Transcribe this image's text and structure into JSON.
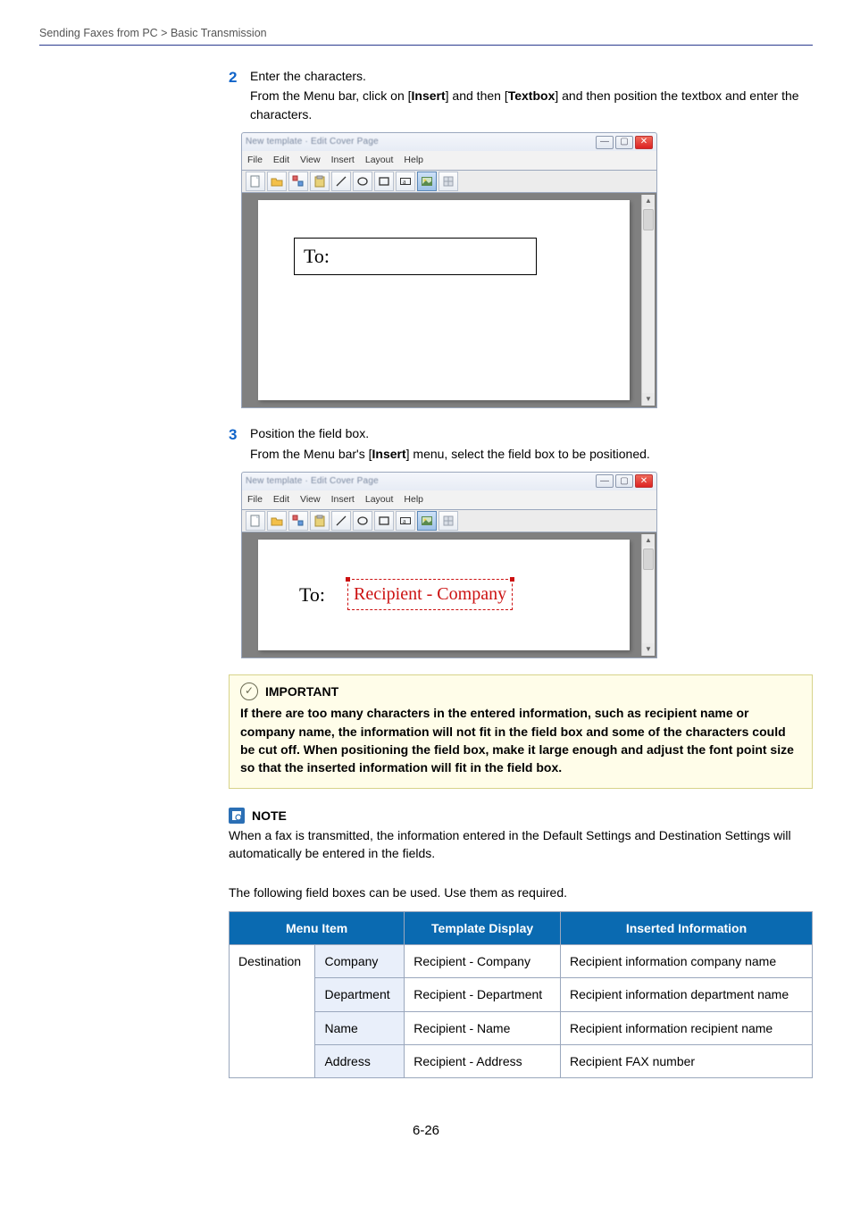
{
  "breadcrumb": "Sending Faxes from PC > Basic Transmission",
  "steps": {
    "s2": {
      "num": "2",
      "title": "Enter the characters.",
      "desc_pre": "From the Menu bar, click on [",
      "desc_b1": "Insert",
      "desc_mid": "] and then [",
      "desc_b2": "Textbox",
      "desc_post": "] and then position the textbox and enter the characters."
    },
    "s3": {
      "num": "3",
      "title": "Position the field box.",
      "desc_pre": "From the Menu bar's [",
      "desc_b1": "Insert",
      "desc_post": "] menu, select the field box to be positioned."
    }
  },
  "win": {
    "title": "New template · Edit Cover Page",
    "menus": [
      "File",
      "Edit",
      "View",
      "Insert",
      "Layout",
      "Help"
    ],
    "textbox1": "To:",
    "labelTo": "To:",
    "fieldtag": "Recipient - Company"
  },
  "important": {
    "title": "IMPORTANT",
    "body": "If there are too many characters in the entered information, such as recipient name or company name, the information will not fit in the field box and some of the characters could be cut off. When positioning the field box, make it large enough and adjust the font point size so that the inserted information will fit in the field box."
  },
  "note": {
    "title": "NOTE",
    "body": "When a fax is transmitted, the information entered in the Default Settings and Destination Settings will automatically be entered in the fields."
  },
  "table_intro": "The following field boxes can be used. Use them as required.",
  "table": {
    "head": {
      "c1": "Menu Item",
      "c2": "Template Display",
      "c3": "Inserted Information"
    },
    "group": "Destination",
    "rows": [
      {
        "sub": "Company",
        "disp": "Recipient - Company",
        "info": "Recipient information company name"
      },
      {
        "sub": "Department",
        "disp": "Recipient - Department",
        "info": "Recipient information department name"
      },
      {
        "sub": "Name",
        "disp": "Recipient - Name",
        "info": "Recipient information recipient name"
      },
      {
        "sub": "Address",
        "disp": "Recipient - Address",
        "info": "Recipient FAX number"
      }
    ]
  },
  "page_num": "6-26"
}
